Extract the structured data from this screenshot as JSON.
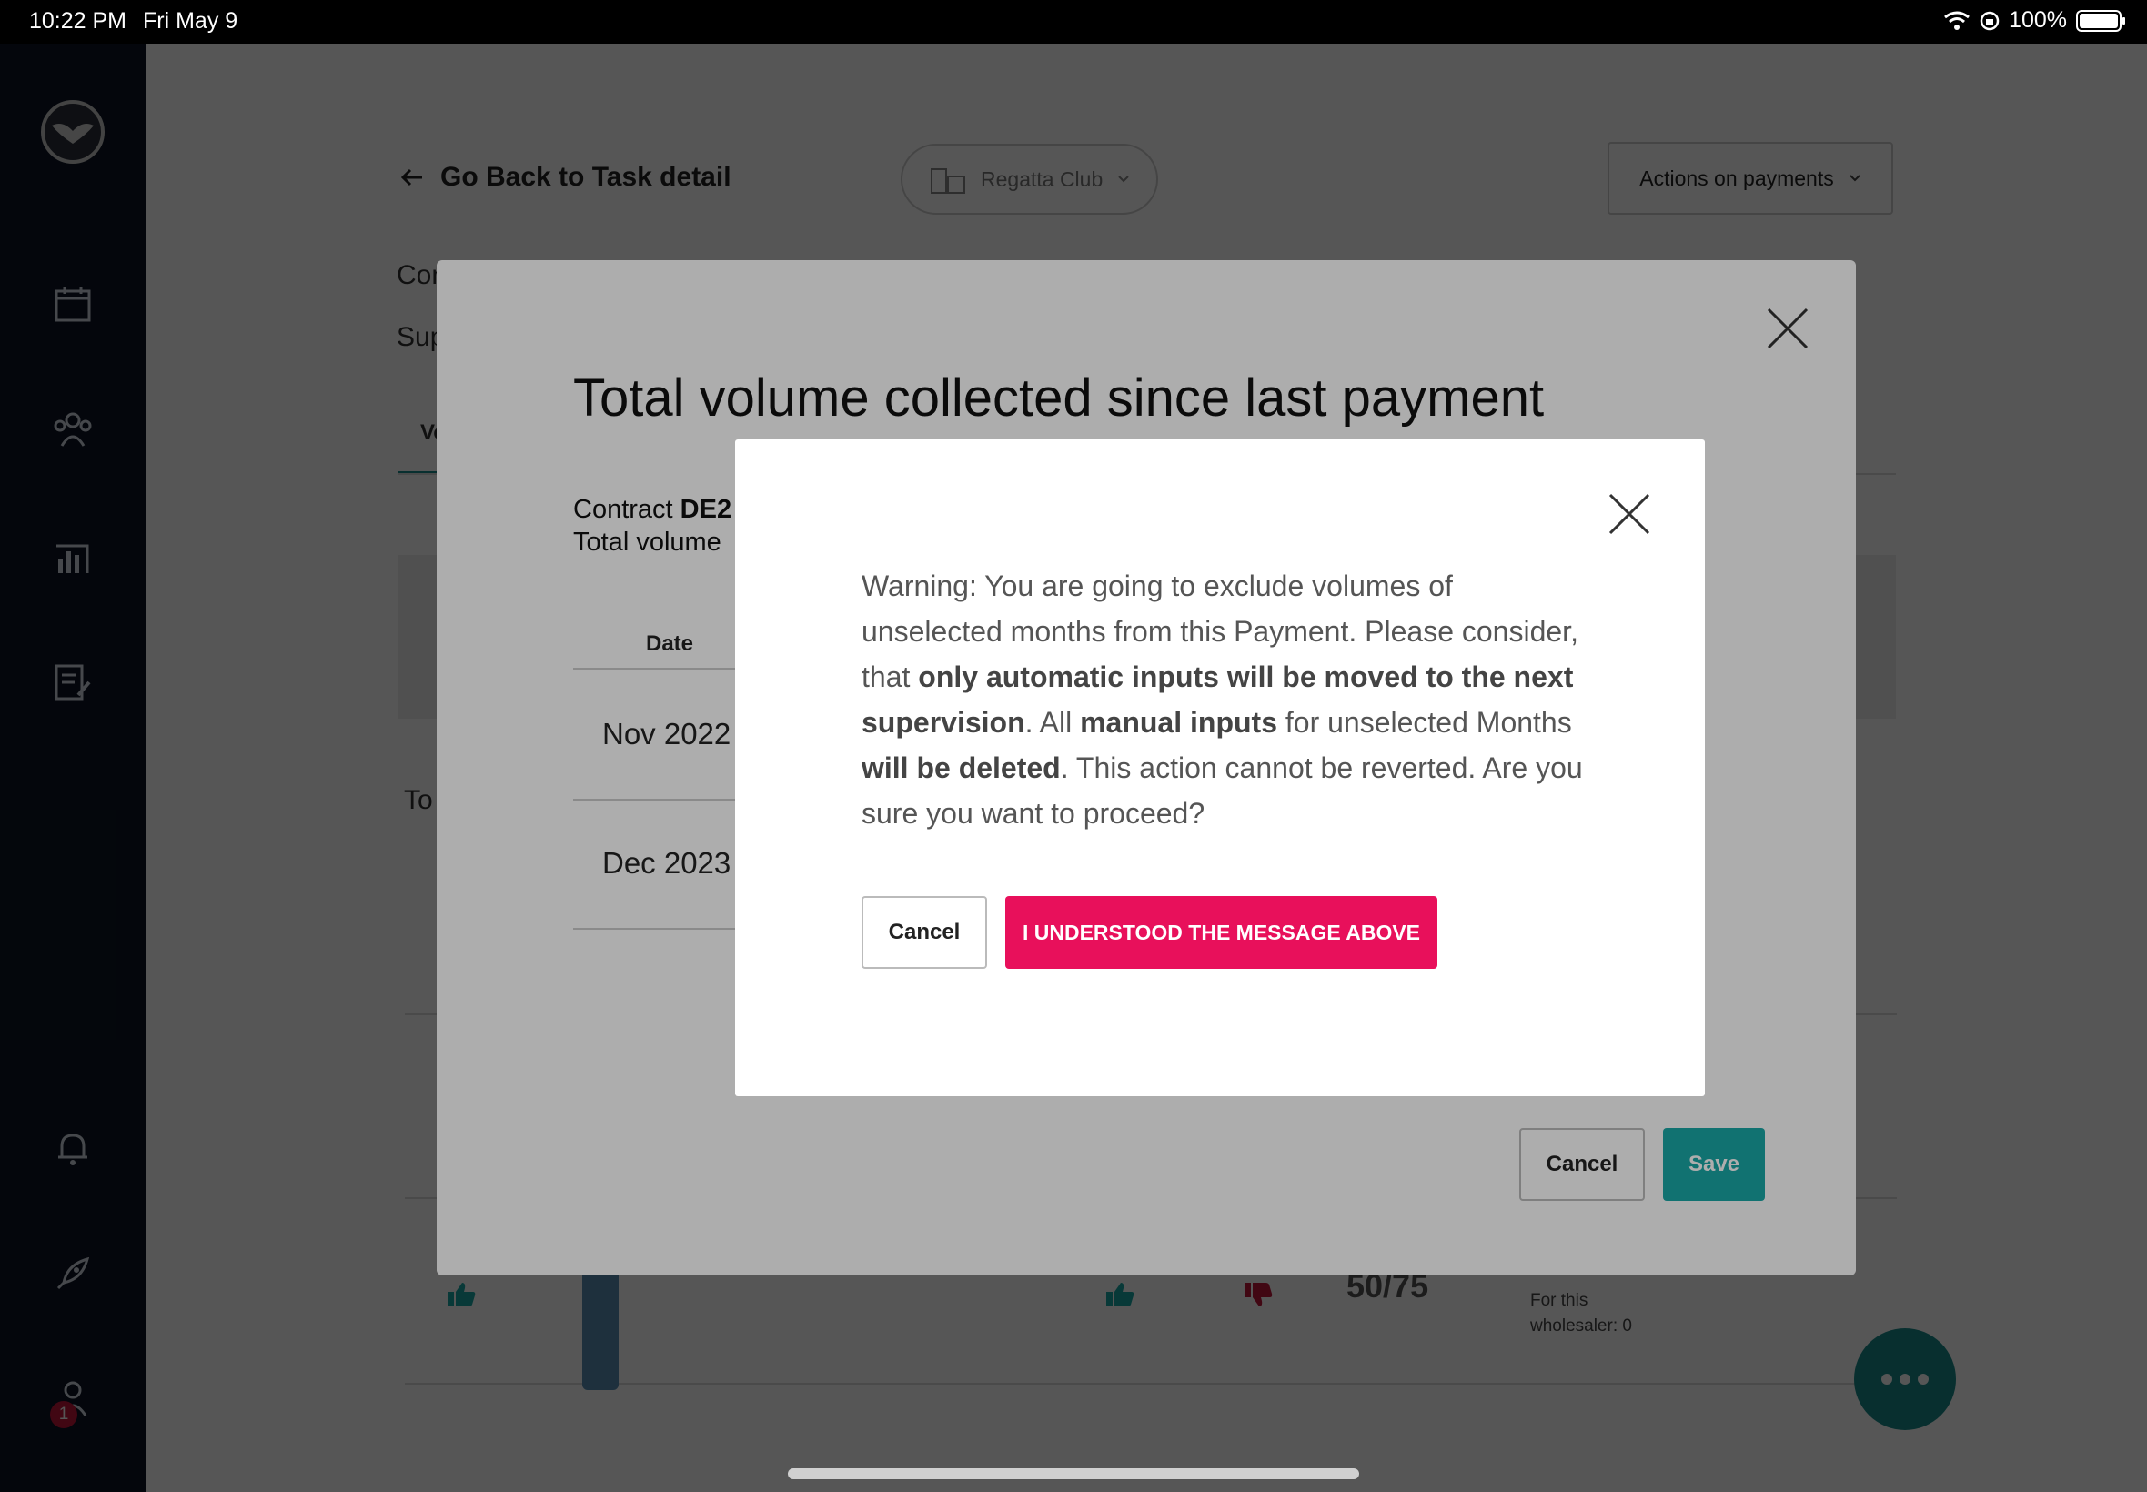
{
  "status_bar": {
    "time": "10:22 PM",
    "date": "Fri May 9",
    "battery": "100%"
  },
  "sidebar": {
    "items": [
      {
        "icon": "calendar-icon"
      },
      {
        "icon": "team-icon"
      },
      {
        "icon": "analytics-icon"
      },
      {
        "icon": "edit-report-icon"
      },
      {
        "icon": "bell-icon"
      },
      {
        "icon": "rocket-icon"
      },
      {
        "icon": "user-icon"
      }
    ],
    "notification_badge": "1"
  },
  "header": {
    "back_label": "Go Back to Task detail",
    "club_name": "Regatta Club",
    "actions_label": "Actions on payments"
  },
  "background": {
    "fragment_con": "Con",
    "fragment_sup": "Sup",
    "fragment_tab": "Vo",
    "fragment_to": "To",
    "score": "50/75",
    "wholesaler_label": "For this",
    "wholesaler_value": "wholesaler: 0"
  },
  "volume_modal": {
    "title": "Total volume collected since last payment",
    "contract_prefix": "Contract ",
    "contract_code": "DE2",
    "total_volume_label": "Total volume",
    "date_header": "Date",
    "rows": [
      "Nov 2022",
      "Dec 2023"
    ],
    "cancel_label": "Cancel",
    "save_label": "Save"
  },
  "warning_dialog": {
    "text_1": "Warning: You are going to exclude volumes of unselected months from this Payment. Please consider, that ",
    "bold_1": "only automatic inputs will be moved to the next supervision",
    "text_2": ". All ",
    "bold_2": "manual inputs",
    "text_3": " for unselected Months ",
    "bold_3": "will be deleted",
    "text_4": ". This action cannot be reverted. Are you sure you want to proceed?",
    "cancel_label": "Cancel",
    "confirm_label": "I UNDERSTOOD THE MESSAGE ABOVE"
  },
  "colors": {
    "confirm": "#e8105b",
    "save": "#1aa9a7",
    "sidebar": "#0c1424"
  }
}
